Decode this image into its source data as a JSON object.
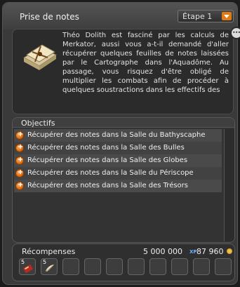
{
  "window": {
    "title": "Prise de notes"
  },
  "step_selector": {
    "selected": "Étape 1"
  },
  "quest": {
    "description": "Théo Dolith est fasciné par les calculs de Merkator, aussi vous a-t-il demandé d'aller récupérer quelques feuilles de notes laissées par le Cartographe dans l'Aquadôme. Au passage, vous risquez d'être obligé de multiplier les combats afin de procéder à quelques soustractions dans les effectifs des",
    "icon": "quest-scroll-icon"
  },
  "objectives": {
    "title": "Objectifs",
    "items": [
      {
        "label": "Récupérer des notes dans la Salle du Bathyscaphe"
      },
      {
        "label": "Récupérer des notes dans la Salle des Bulles"
      },
      {
        "label": "Récupérer des notes dans la Salle des Globes"
      },
      {
        "label": "Récupérer des notes dans la Salle du Périscope"
      },
      {
        "label": "Récupérer des notes dans la Salle des Trésors"
      }
    ]
  },
  "rewards": {
    "title": "Récompenses",
    "xp": "5 000 000",
    "xp_icon": "XP",
    "kamas": "87 960",
    "items": [
      {
        "qty": "5",
        "icon": "red-item-icon"
      },
      {
        "qty": "5",
        "icon": "feather-item-icon"
      }
    ],
    "empty_slots": 8
  },
  "colors": {
    "accent": "#e07a12",
    "panel": "#3a3a3a"
  }
}
